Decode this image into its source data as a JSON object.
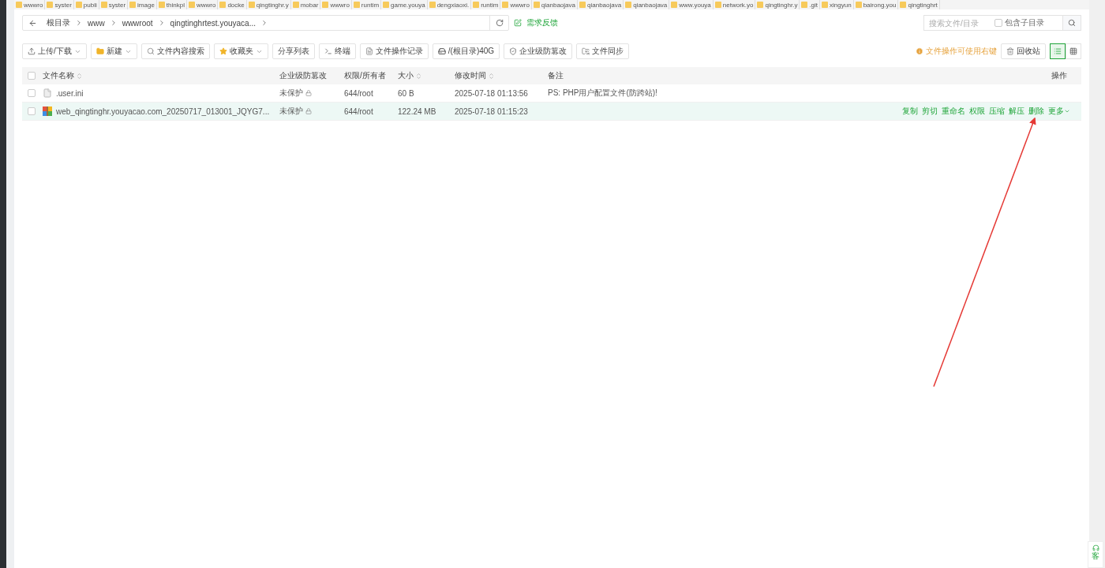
{
  "folder_tabs": [
    "wwwro",
    "syster",
    "publi",
    "syster",
    "image",
    "thinkpl",
    "wwwro",
    "docke",
    "qingtinghr.y",
    "mobar",
    "wwwro",
    "runtim",
    "game.youya",
    "dengxiaoxi.",
    "runtim",
    "wwwro",
    "qianbaojava",
    "qianbaojava",
    "qianbaojava",
    "www.youya",
    "network.yo",
    "qingtinghr.y",
    ".git",
    "xingyun",
    "bairong.you",
    "qingtinghrt"
  ],
  "breadcrumb": [
    "根目录",
    "www",
    "wwwroot",
    "qingtinghrtest.youyaca..."
  ],
  "feedback": "需求反馈",
  "search": {
    "placeholder": "搜索文件/目录",
    "include_sub": {
      "label": "包含子目录",
      "checked": false
    }
  },
  "toolbar": [
    {
      "label": "上传/下载",
      "dropdown": true
    },
    {
      "label": "新建",
      "dropdown": true
    },
    {
      "label": "文件内容搜索",
      "dropdown": false
    },
    {
      "label": "收藏夹",
      "dropdown": true
    },
    {
      "label": "分享列表",
      "dropdown": false
    },
    {
      "label": "终端",
      "dropdown": false
    },
    {
      "label": "文件操作记录",
      "dropdown": false
    },
    {
      "label": "/(根目录)40G",
      "dropdown": false
    },
    {
      "label": "企业级防篡改",
      "dropdown": false
    },
    {
      "label": "文件同步",
      "dropdown": false
    }
  ],
  "hint": "文件操作可使用右键",
  "recycle": "回收站",
  "views": [
    {
      "kind": "list",
      "selected": true
    },
    {
      "kind": "grid",
      "selected": false
    }
  ],
  "select_all": {
    "checked": false
  },
  "columns": [
    {
      "label": "文件名称",
      "sortable": true
    },
    {
      "label": "企业级防篡改",
      "sortable": false
    },
    {
      "label": "权限/所有者",
      "sortable": false
    },
    {
      "label": "大小",
      "sortable": true
    },
    {
      "label": "修改时间",
      "sortable": true
    },
    {
      "label": "备注",
      "sortable": false
    },
    {
      "label": "操作",
      "sortable": false
    }
  ],
  "rows": [
    {
      "kind": "file",
      "checked": false,
      "selected": false,
      "name": ".user.ini",
      "protection": "未保护",
      "perm": "644/root",
      "size": "60 B",
      "time": "2025-07-18 01:13:56",
      "note": "PS: PHP用户配置文件(防跨站)!",
      "actions": []
    },
    {
      "kind": "archive",
      "checked": false,
      "selected": true,
      "name": "web_qingtinghr.youyacao.com_20250717_013001_JQYG7...",
      "protection": "未保护",
      "perm": "644/root",
      "size": "122.24 MB",
      "time": "2025-07-18 01:15:23",
      "actions": [
        "复制",
        "剪切",
        "重命名",
        "权限",
        "压缩",
        "解压",
        "删除",
        "更多"
      ]
    }
  ],
  "service": "客"
}
